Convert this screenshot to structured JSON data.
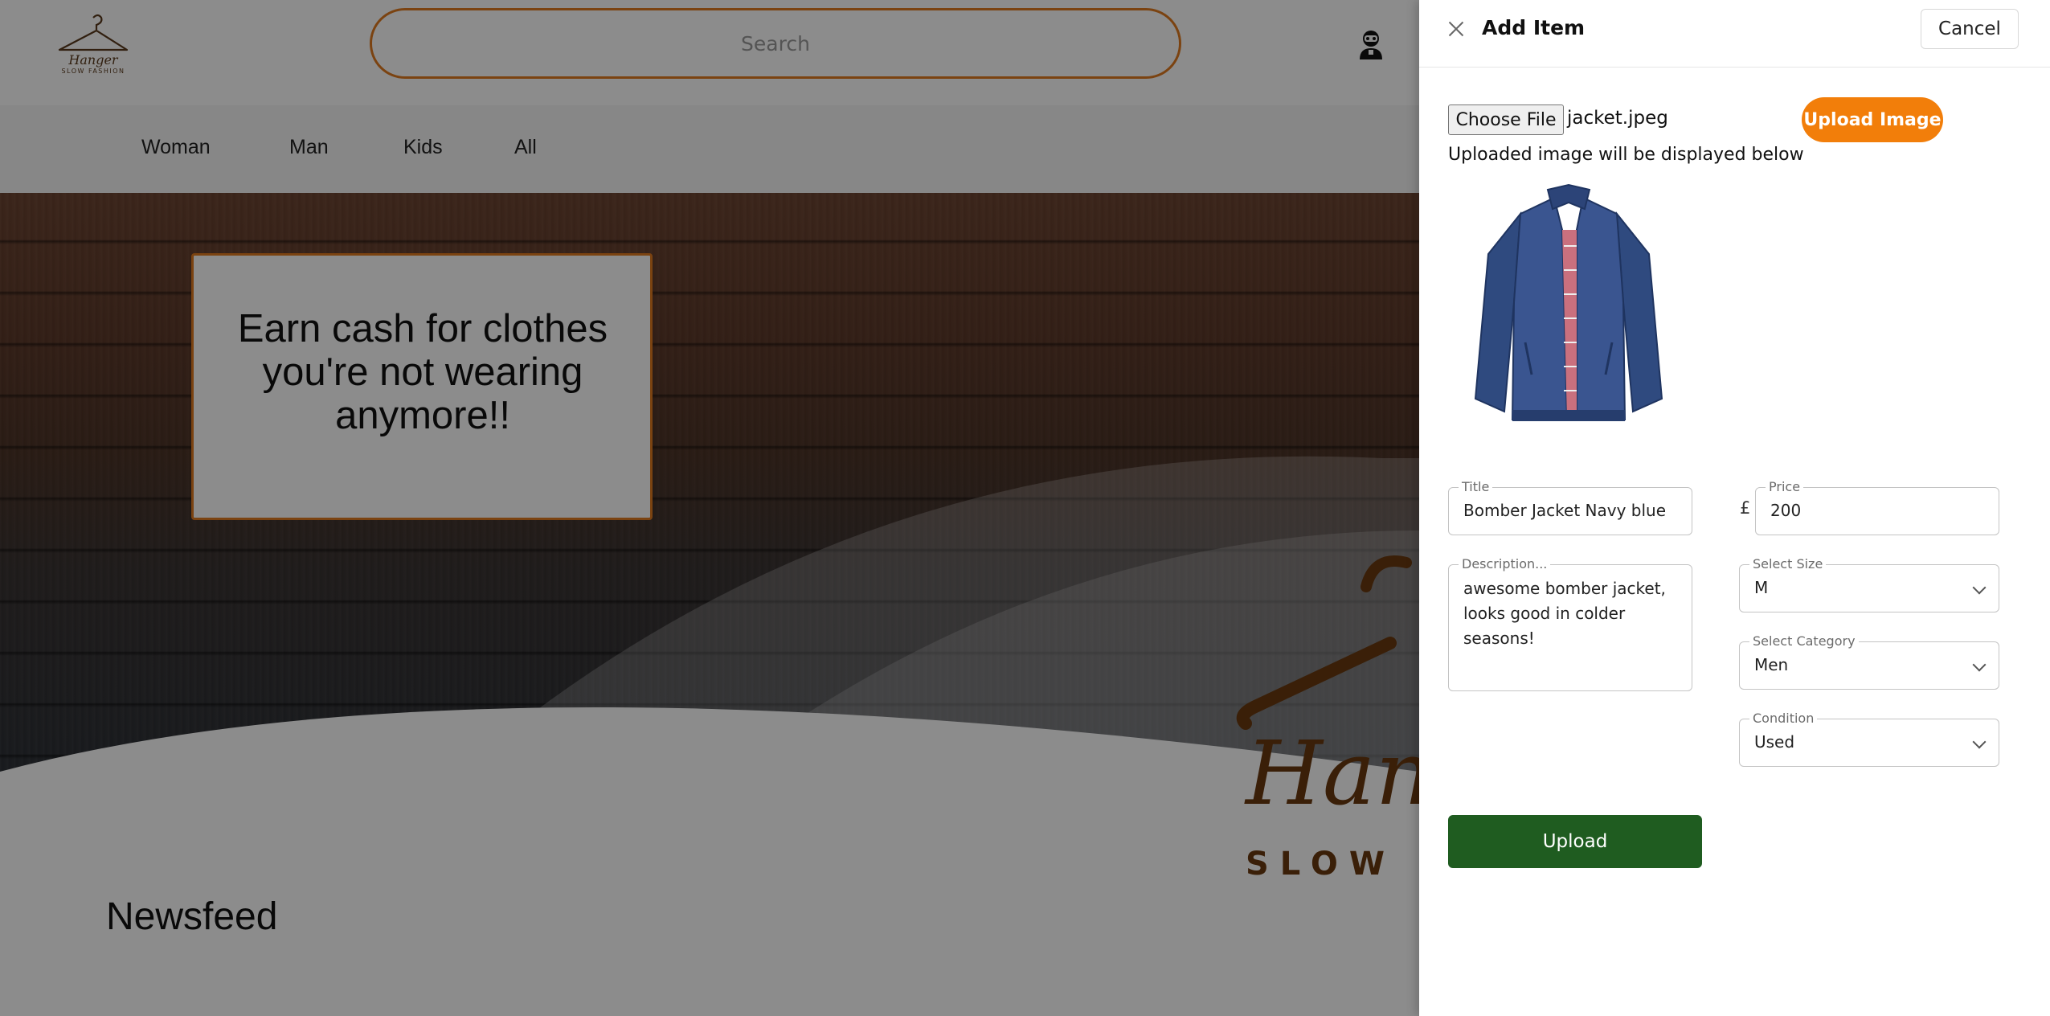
{
  "header": {
    "logo_name": "Hanger",
    "logo_tagline": "SLOW FASHION",
    "search_placeholder": "Search",
    "user_icon": "user-avatar-icon"
  },
  "nav": {
    "items": [
      {
        "label": "Woman"
      },
      {
        "label": "Man"
      },
      {
        "label": "Kids"
      },
      {
        "label": "All"
      }
    ]
  },
  "hero": {
    "promo_text": "Earn cash for clothes you're not wearing anymore!!",
    "brand_script": "Han",
    "brand_tagline": "SLOW F"
  },
  "main": {
    "section_title": "Newsfeed"
  },
  "drawer": {
    "title": "Add Item",
    "close_icon": "close-icon",
    "cancel_label": "Cancel",
    "choose_file_label": "Choose File",
    "file_name": "jacket.jpeg",
    "upload_image_label": "Upload Image",
    "upload_note": "Uploaded image will be displayed below",
    "preview_alt": "jacket-image",
    "fields": {
      "title": {
        "label": "Title",
        "value": "Bomber Jacket Navy blue"
      },
      "price": {
        "label": "Price",
        "currency": "£",
        "value": "200"
      },
      "description": {
        "label": "Description...",
        "value": "awesome bomber jacket, looks good in colder seasons!"
      },
      "size": {
        "label": "Select Size",
        "value": "M"
      },
      "category": {
        "label": "Select Category",
        "value": "Men"
      },
      "condition": {
        "label": "Condition",
        "value": "Used"
      }
    },
    "upload_label": "Upload"
  },
  "colors": {
    "accent_orange": "#f27e0a",
    "search_border": "#e07a1f",
    "upload_green": "#1f5c20",
    "brand_brown": "#6a3a10"
  }
}
